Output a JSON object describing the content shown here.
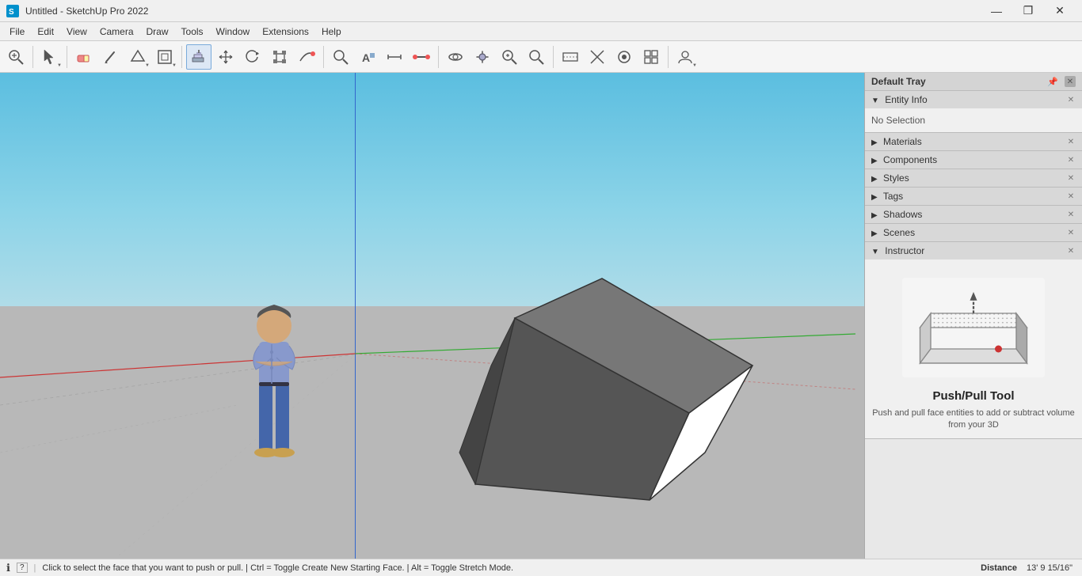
{
  "titlebar": {
    "title": "Untitled - SketchUp Pro 2022",
    "minimize": "—",
    "maximize": "❐",
    "close": "✕"
  },
  "menubar": {
    "items": [
      "File",
      "Edit",
      "View",
      "Camera",
      "Draw",
      "Tools",
      "Window",
      "Extensions",
      "Help"
    ]
  },
  "toolbar": {
    "tools": [
      {
        "name": "zoom-extents",
        "icon": "🔍",
        "has_dropdown": false
      },
      {
        "name": "select",
        "icon": "↖",
        "has_dropdown": true,
        "active": false
      },
      {
        "name": "eraser",
        "icon": "◻",
        "has_dropdown": false
      },
      {
        "name": "pencil",
        "icon": "✏",
        "has_dropdown": false
      },
      {
        "name": "shapes",
        "icon": "◱",
        "has_dropdown": true
      },
      {
        "name": "offset",
        "icon": "⊡",
        "has_dropdown": true
      },
      {
        "name": "push-pull",
        "icon": "⬡",
        "has_dropdown": false,
        "active": true
      },
      {
        "name": "move",
        "icon": "✛",
        "has_dropdown": false
      },
      {
        "name": "rotate",
        "icon": "↻",
        "has_dropdown": false
      },
      {
        "name": "scale",
        "icon": "⤢",
        "has_dropdown": false
      },
      {
        "name": "follow-me",
        "icon": "▶",
        "has_dropdown": false
      },
      {
        "name": "search",
        "icon": "🔍",
        "has_dropdown": false
      },
      {
        "name": "text",
        "icon": "A",
        "has_dropdown": false
      },
      {
        "name": "dimension",
        "icon": "↔",
        "has_dropdown": false
      },
      {
        "name": "tape",
        "icon": "📏",
        "has_dropdown": false
      },
      {
        "name": "orbit",
        "icon": "⊕",
        "has_dropdown": false
      },
      {
        "name": "pan",
        "icon": "✋",
        "has_dropdown": false
      },
      {
        "name": "zoom",
        "icon": "🔎",
        "has_dropdown": false
      },
      {
        "name": "zoom-window",
        "icon": "⊞",
        "has_dropdown": false
      },
      {
        "name": "style1",
        "icon": "⬡",
        "has_dropdown": false
      },
      {
        "name": "style2",
        "icon": "✕",
        "has_dropdown": false
      },
      {
        "name": "style3",
        "icon": "⊛",
        "has_dropdown": false
      },
      {
        "name": "style4",
        "icon": "⊞",
        "has_dropdown": false
      },
      {
        "name": "account",
        "icon": "👤",
        "has_dropdown": true
      }
    ]
  },
  "right_panel": {
    "tray_title": "Default Tray",
    "sections": [
      {
        "id": "entity-info",
        "label": "Entity Info",
        "expanded": true,
        "content": "No Selection"
      },
      {
        "id": "materials",
        "label": "Materials",
        "expanded": false
      },
      {
        "id": "components",
        "label": "Components",
        "expanded": false
      },
      {
        "id": "styles",
        "label": "Styles",
        "expanded": false
      },
      {
        "id": "tags",
        "label": "Tags",
        "expanded": false
      },
      {
        "id": "shadows",
        "label": "Shadows",
        "expanded": false
      },
      {
        "id": "scenes",
        "label": "Scenes",
        "expanded": false
      },
      {
        "id": "instructor",
        "label": "Instructor",
        "expanded": true
      }
    ],
    "instructor": {
      "tool_name": "Push/Pull Tool",
      "description": "Push and pull face entities to add or subtract volume from your 3D"
    }
  },
  "statusbar": {
    "info_icon": "ℹ",
    "message": "Click to select the face that you want to push or pull. | Ctrl = Toggle Create New Starting Face. | Alt = Toggle Stretch Mode.",
    "distance_label": "Distance",
    "distance_value": "13' 9 15/16\""
  }
}
